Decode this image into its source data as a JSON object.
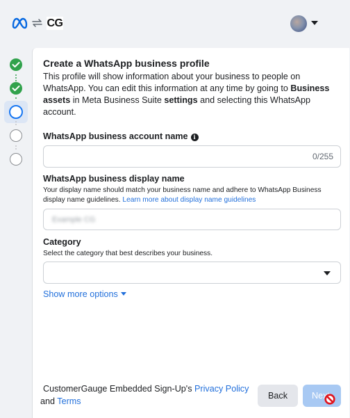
{
  "header": {
    "logo": "meta-logo",
    "app_badge": "CG",
    "account_menu_icon": "chevron-down-icon"
  },
  "stepper": {
    "steps": [
      {
        "state": "complete"
      },
      {
        "state": "complete"
      },
      {
        "state": "current"
      },
      {
        "state": "incomplete"
      },
      {
        "state": "incomplete"
      }
    ]
  },
  "form": {
    "title": "Create a WhatsApp business profile",
    "intro": {
      "part1": "This profile will show information about your business to people on WhatsApp. You can edit this information at any time by going to ",
      "bold1": "Business assets",
      "part2": " in Meta Business Suite ",
      "bold2": "settings",
      "part3": " and selecting this WhatsApp account."
    },
    "account_name": {
      "label": "WhatsApp business account name",
      "value": "",
      "counter": "0/255"
    },
    "display_name": {
      "label": "WhatsApp business display name",
      "help": "Your display name should match your business name and adhere to WhatsApp Business display name guidelines. ",
      "help_link": "Learn more about display name guidelines",
      "value": "Example CG"
    },
    "category": {
      "label": "Category",
      "help": "Select the category that best describes your business.",
      "value": ""
    },
    "show_more": "Show more options"
  },
  "footer": {
    "text1": "CustomerGauge Embedded Sign-Up's ",
    "privacy_link": "Privacy Policy",
    "text2": " and ",
    "terms_link": "Terms",
    "back_label": "Back",
    "next_label": "Next"
  },
  "colors": {
    "accent": "#1877f2",
    "success": "#31a24c",
    "link": "#216fdb",
    "next_disabled": "#a8c9f3"
  }
}
